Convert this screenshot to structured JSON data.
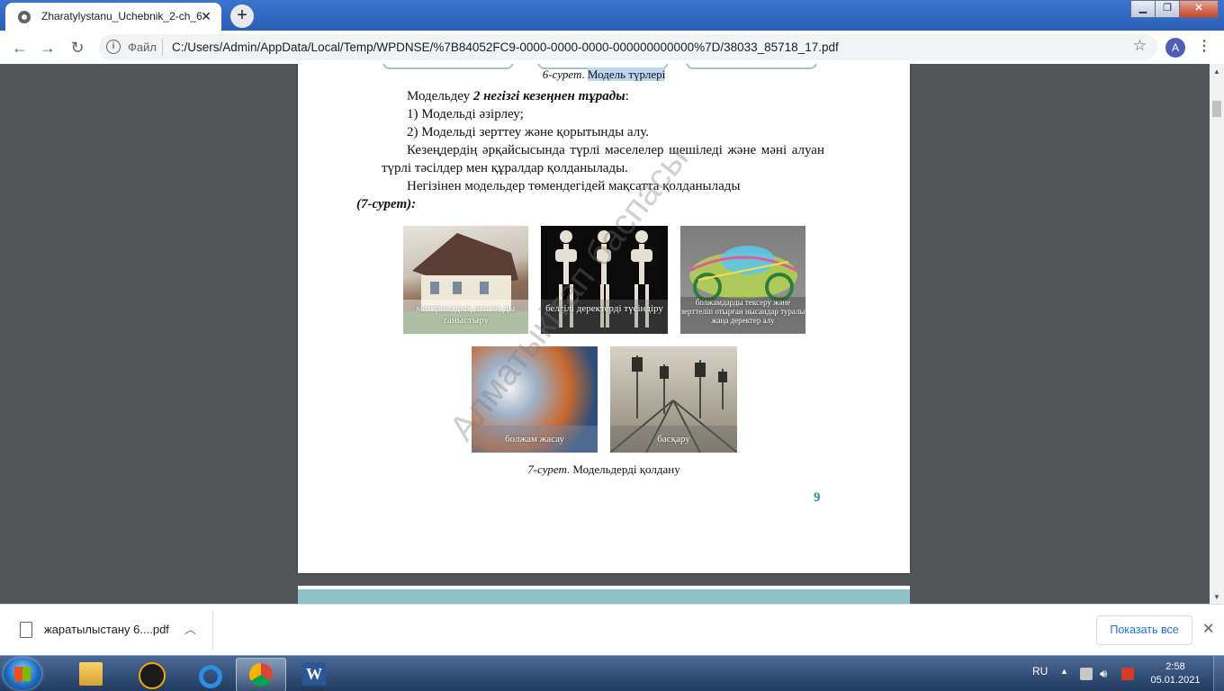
{
  "browser": {
    "tab_title": "Zharatylystanu_Uchebnik_2-ch_6",
    "scheme_label": "Файл",
    "url": "C:/Users/Admin/AppData/Local/Temp/WPDNSE/%7B84052FC9-0000-0000-0000-000000000000%7D/38033_85718_17.pdf",
    "avatar_letter": "A"
  },
  "document": {
    "figure6_caption_num": "6-сурет",
    "figure6_caption_text": "Модель түрлері",
    "para1_start": "Модельдеу ",
    "para1_emph": "2 негізгі кезеңнен тұрады",
    "para1_end": ":",
    "item1": "1)  Модельді әзірлеу;",
    "item2": "2)  Модельді зерттеу және қорытынды алу.",
    "para2": "Кезеңдердің әрқайсысында түрлі мәселелер шешіледі және мәні алуан түрлі тәсілдер мен құралдар қолданылады.",
    "para3": "Негізінен модельдер төмендегідей мақсатта қолданылады",
    "para3_ref": "(7-сурет):",
    "images": {
      "house": "материалдық нысан-ды таныстыру",
      "skeleton": "белгілі деректерді түсіндіру",
      "car": "болжамдарды тексеру және зерттеліп отырған нысандар туралы жаңа деректер алу",
      "weather": "болжам жасау",
      "rail": "басқару"
    },
    "figure7_caption_num": "7-сурет",
    "figure7_caption_text": "Модельдерді қолдану",
    "page_number": "9",
    "watermark": "Алматыкітап баспасы"
  },
  "downloads": {
    "file_name": "жаратылыстану 6....pdf",
    "show_all": "Показать все"
  },
  "taskbar": {
    "language": "RU",
    "time": "2:58",
    "date": "05.01.2021"
  }
}
